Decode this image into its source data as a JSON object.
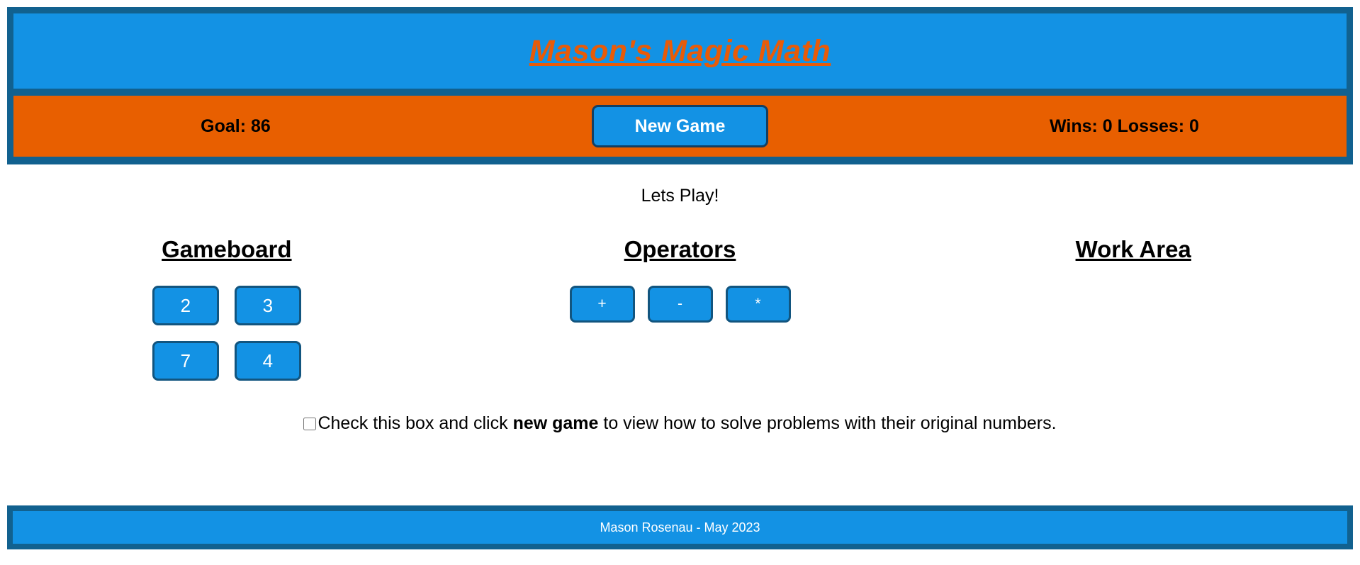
{
  "header": {
    "title": "Mason's Magic Math",
    "goal_label": "Goal: 86",
    "new_game_label": "New Game",
    "score_label": "Wins: 0 Losses: 0",
    "title_color": "#e85b08",
    "bar_color": "#e85f00",
    "panel_color": "#1392e4",
    "border_color": "#11618f"
  },
  "message": {
    "text": "Lets Play!"
  },
  "gameboard": {
    "heading": "Gameboard",
    "tiles": [
      "2",
      "3",
      "7",
      "4"
    ]
  },
  "operators": {
    "heading": "Operators",
    "buttons": [
      "+",
      "-",
      "*"
    ]
  },
  "work_area": {
    "heading": "Work Area",
    "content": ""
  },
  "hint": {
    "text_before": "Check this box and click ",
    "text_bold": "new game",
    "text_after": " to view how to solve problems with their original numbers.",
    "checked": false
  },
  "footer": {
    "text": "Mason Rosenau - May 2023"
  }
}
